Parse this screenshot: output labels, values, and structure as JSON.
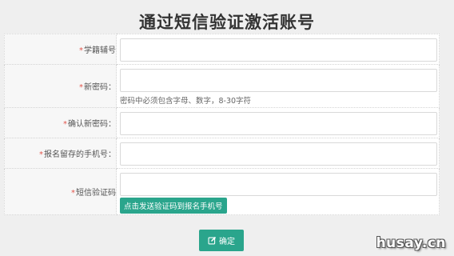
{
  "page": {
    "title": "通过短信验证激活账号"
  },
  "form": {
    "rows": [
      {
        "label": "学籍辅号",
        "value": "",
        "placeholder": ""
      },
      {
        "label": "新密码：",
        "value": "",
        "placeholder": "",
        "hint": "密码中必须包含字母、数字，8-30字符"
      },
      {
        "label": "确认新密码：",
        "value": "",
        "placeholder": ""
      },
      {
        "label": "报名留存的手机号：",
        "value": "",
        "placeholder": ""
      },
      {
        "label": "短信验证码",
        "value": "",
        "placeholder": "",
        "button": "点击发送验证码到报名手机号"
      }
    ],
    "required_mark": "*",
    "submit_label": "确定"
  },
  "watermark": "husay.cn",
  "colors": {
    "accent": "#2aa58c",
    "required": "#e2564c",
    "background": "#efefef"
  },
  "icons": {
    "submit_icon": "edit-icon"
  }
}
